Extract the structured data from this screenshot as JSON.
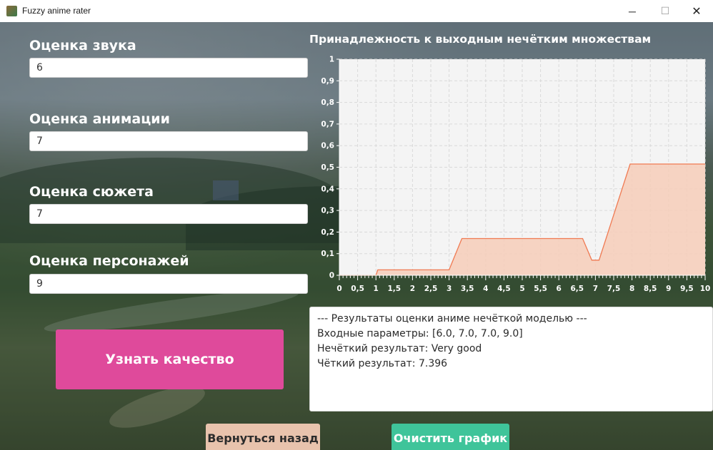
{
  "window": {
    "title": "Fuzzy anime rater",
    "minimize_glyph": "─",
    "maximize_glyph": "☐",
    "close_glyph": "✕"
  },
  "fields": [
    {
      "label": "Оценка звука",
      "value": "6"
    },
    {
      "label": "Оценка анимации",
      "value": "7"
    },
    {
      "label": "Оценка сюжета",
      "value": "7"
    },
    {
      "label": "Оценка персонажей",
      "value": "9"
    }
  ],
  "actions": {
    "quality_label": "Узнать качество",
    "back_label": "Вернуться назад",
    "clear_label": "Очистить график"
  },
  "results": {
    "lines": [
      "--- Результаты оценки аниме нечёткой моделью ---",
      "Входные параметры: [6.0, 7.0, 7.0, 9.0]",
      "Нечёткий результат: Very good",
      "Чёткий результат: 7.396"
    ]
  },
  "colors": {
    "quality_button": "#df4a9b",
    "back_button": "#e8c3ad",
    "clear_button": "#3fc49a",
    "line": "#f07a52",
    "area": "#f6cdb9"
  },
  "chart_data": {
    "type": "area",
    "title": "Принадлежность к выходным нечётким множествам",
    "xlabel": "",
    "ylabel": "",
    "xlim": [
      0,
      10
    ],
    "ylim": [
      0,
      1
    ],
    "grid": true,
    "x_ticks": [
      "0",
      "0,5",
      "1",
      "1,5",
      "2",
      "2,5",
      "3",
      "3,5",
      "4",
      "4,5",
      "5",
      "5,5",
      "6",
      "6,5",
      "7",
      "7,5",
      "8",
      "8,5",
      "9",
      "9,5",
      "10"
    ],
    "y_ticks": [
      "0",
      "0,1",
      "0,2",
      "0,3",
      "0,4",
      "0,5",
      "0,6",
      "0,7",
      "0,8",
      "0,9",
      "1"
    ],
    "series": [
      {
        "x": [
          0,
          1,
          1.05,
          3.0,
          3.35,
          6.65,
          6.9,
          7.1,
          7.95,
          10
        ],
        "y": [
          0,
          0,
          0.025,
          0.025,
          0.17,
          0.17,
          0.07,
          0.07,
          0.515,
          0.515
        ]
      }
    ]
  }
}
